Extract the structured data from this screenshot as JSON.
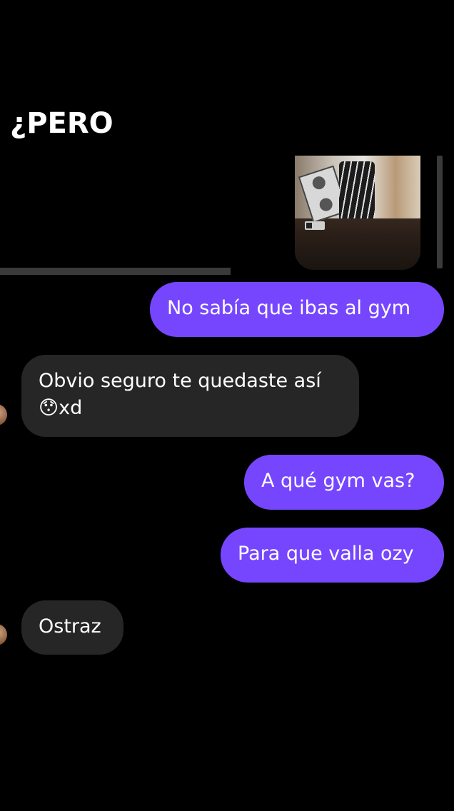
{
  "overlay": {
    "caption": "¿PERO"
  },
  "story_reply": {
    "thumbnail_icon": "story-photo"
  },
  "messages": [
    {
      "direction": "out",
      "text": "No sabía que ibas al gym"
    },
    {
      "direction": "in",
      "text": "Obvio seguro te quedaste así\n😯xd"
    },
    {
      "direction": "out",
      "text": "A qué gym vas?"
    },
    {
      "direction": "out",
      "text": "Para que valla ozy"
    },
    {
      "direction": "in",
      "text": "Ostraz"
    }
  ],
  "colors": {
    "background": "#000000",
    "outgoing_bubble": "#7646ff",
    "incoming_bubble": "#262626",
    "text": "#ffffff"
  }
}
